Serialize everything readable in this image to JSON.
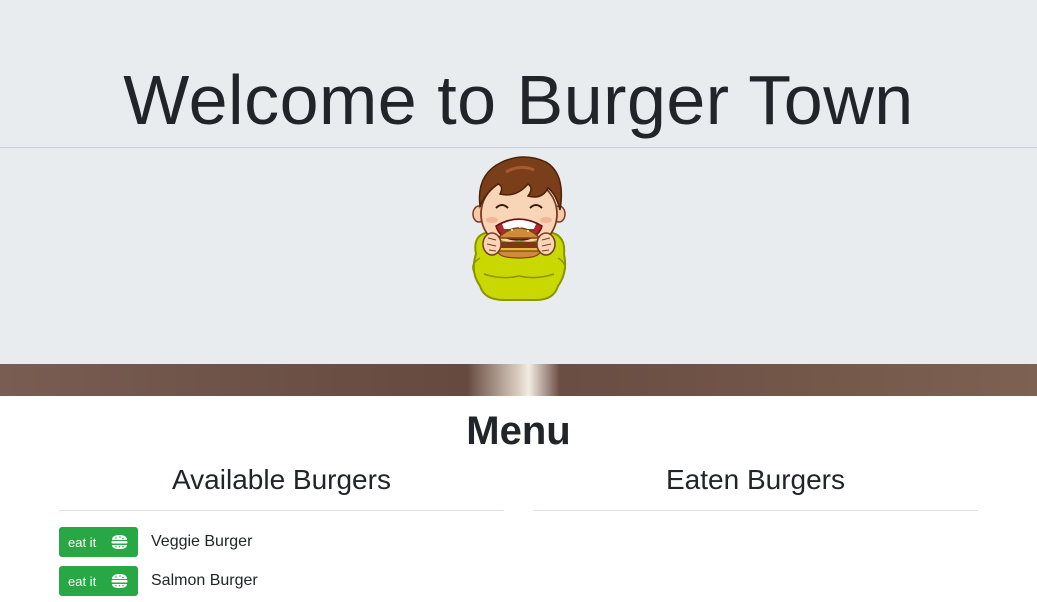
{
  "header": {
    "title": "Welcome to Burger Town"
  },
  "menu": {
    "title": "Menu",
    "available_title": "Available Burgers",
    "eaten_title": "Eaten Burgers",
    "available": [
      {
        "button_label": "eat it",
        "name": "Veggie Burger"
      },
      {
        "button_label": "eat it",
        "name": "Salmon Burger"
      }
    ],
    "eaten": []
  },
  "colors": {
    "jumbotron_bg": "#e9ecef",
    "button_green": "#28a745",
    "text": "#212529"
  },
  "icons": {
    "mascot": "kid-eating-burger-illustration",
    "button_icon": "hamburger-icon"
  }
}
